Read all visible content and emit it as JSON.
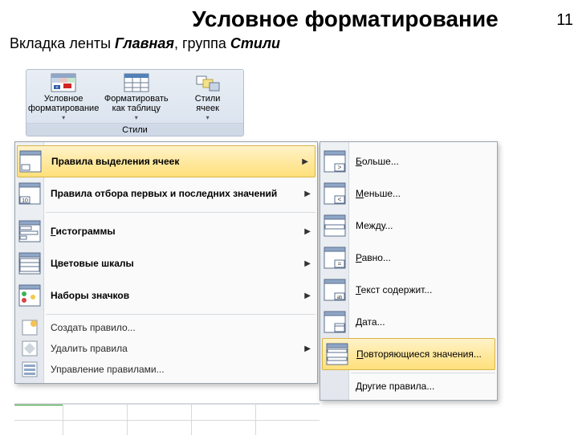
{
  "page": {
    "title": "Условное форматирование",
    "number": "11"
  },
  "subtitle": {
    "prefix": "Вкладка ленты ",
    "tab": "Главная",
    "mid": ", группа ",
    "group": "Стили"
  },
  "ribbon": {
    "caption": "Стили",
    "buttons": {
      "cond": {
        "l1": "Условное",
        "l2": "форматирование"
      },
      "fmt_table": {
        "l1": "Форматировать",
        "l2": "как таблицу"
      },
      "cell_styles": {
        "l1": "Стили",
        "l2": "ячеек"
      }
    }
  },
  "menu": {
    "highlight": "Правила выделения ячеек",
    "topbottom": "Правила отбора первых и последних значений",
    "databars": "Гистограммы",
    "colorscales": "Цветовые шкалы",
    "iconsets": "Наборы значков",
    "newrule": "Создать правило...",
    "clear": "Удалить правила",
    "manage": "Управление правилами..."
  },
  "submenu": {
    "greater": "Больше...",
    "less": "Меньше...",
    "between": "Между...",
    "equal": "Равно...",
    "textcont": "Текст содержит...",
    "date": "Дата...",
    "dup": "Повторяющиеся значения...",
    "more": "Другие правила..."
  }
}
